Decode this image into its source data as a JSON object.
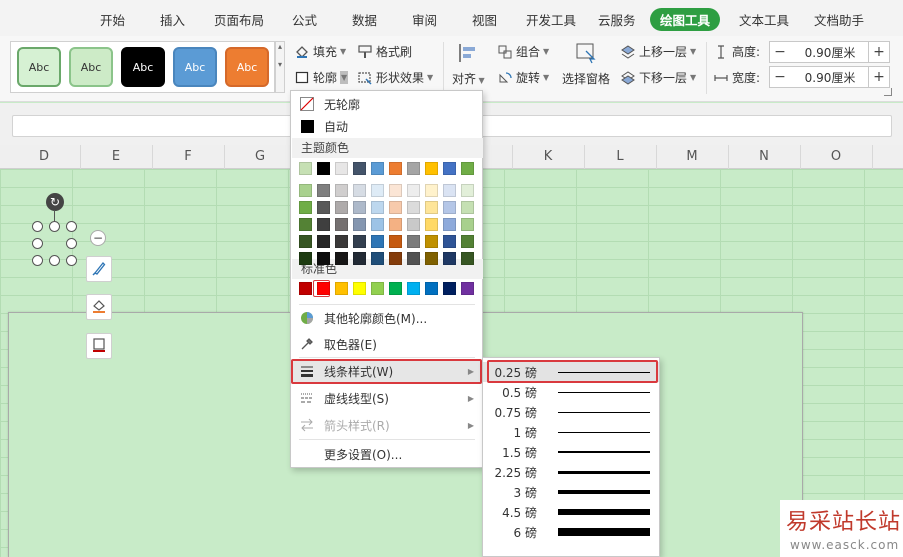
{
  "menu_tabs": [
    "开始",
    "插入",
    "页面布局",
    "公式",
    "数据",
    "审阅",
    "视图",
    "开发工具",
    "云服务",
    "绘图工具",
    "文本工具",
    "文档助手"
  ],
  "style_gallery": [
    {
      "label": "Abc",
      "bg": "#d6f1d3",
      "border": "#6aa86a",
      "color": "#333333"
    },
    {
      "label": "Abc",
      "bg": "#cdebc7",
      "border": "#8bc48a",
      "color": "#333333"
    },
    {
      "label": "Abc",
      "bg": "#000000",
      "border": "#000000",
      "color": "#ffffff"
    },
    {
      "label": "Abc",
      "bg": "#5b9bd5",
      "border": "#4a86bd",
      "color": "#ffffff"
    },
    {
      "label": "Abc",
      "bg": "#ed7d31",
      "border": "#d5692a",
      "color": "#ffffff"
    }
  ],
  "ribbon": {
    "fill": "填充",
    "format_painter": "格式刷",
    "outline": "轮廓",
    "shape_effects": "形状效果",
    "align": "对齐",
    "group": "组合",
    "rotate": "旋转",
    "selection_pane": "选择窗格",
    "bring_forward": "上移一层",
    "send_backward": "下移一层",
    "height_label": "高度:",
    "height_value": "0.90厘米",
    "width_label": "宽度:",
    "width_value": "0.90厘米",
    "minus": "−",
    "plus": "+"
  },
  "columns": [
    "D",
    "E",
    "F",
    "G",
    "H",
    "I",
    "J",
    "K",
    "L",
    "M",
    "N",
    "O"
  ],
  "dropdown": {
    "no_outline": "无轮廓",
    "auto": "自动",
    "theme_colors_title": "主题颜色",
    "theme_top_row": [
      "#c6e0b4",
      "#000000",
      "#e7e6e6",
      "#44546a",
      "#5b9bd5",
      "#ed7d31",
      "#a5a5a5",
      "#ffc000",
      "#4472c4",
      "#70ad47"
    ],
    "theme_shades": [
      [
        "#a9d18e",
        "#7f7f7f",
        "#d0cece",
        "#d6dce4",
        "#deebf6",
        "#fbe5d5",
        "#ededed",
        "#fff2cc",
        "#dae3f3",
        "#e2efd9"
      ],
      [
        "#70ad47",
        "#595959",
        "#aeaaaa",
        "#adb9ca",
        "#bdd7ee",
        "#f7caac",
        "#dbdbdb",
        "#fee599",
        "#b4c6e7",
        "#c5e0b3"
      ],
      [
        "#548235",
        "#3f3f3f",
        "#757070",
        "#8496b0",
        "#9dc3e6",
        "#f4b183",
        "#c9c9c9",
        "#ffd966",
        "#8eaadb",
        "#a8d08d"
      ],
      [
        "#375623",
        "#262626",
        "#3a3838",
        "#333f4f",
        "#2e75b5",
        "#c55a11",
        "#7b7b7b",
        "#bf9000",
        "#2f5496",
        "#538135"
      ],
      [
        "#1e3c12",
        "#0d0d0d",
        "#171616",
        "#222a35",
        "#1f4e79",
        "#843c0b",
        "#525252",
        "#7f6000",
        "#1f3864",
        "#375623"
      ]
    ],
    "standard_colors_title": "标准色",
    "standard_colors": [
      "#c00000",
      "#ff0000",
      "#ffc000",
      "#ffff00",
      "#92d050",
      "#00b050",
      "#00b0f0",
      "#0070c0",
      "#002060",
      "#7030a0"
    ],
    "more_colors": "其他轮廓颜色(M)...",
    "eyedropper": "取色器(E)",
    "line_style": "线条样式(W)",
    "dash_type": "虚线线型(S)",
    "arrow_style": "箭头样式(R)",
    "more_settings": "更多设置(O)..."
  },
  "line_weights": [
    "0.25 磅",
    "0.5 磅",
    "0.75 磅",
    "1 磅",
    "1.5 磅",
    "2.25 磅",
    "3 磅",
    "4.5 磅",
    "6 磅"
  ],
  "line_weight_values": [
    0.25,
    0.5,
    0.75,
    1,
    1.5,
    2.25,
    3,
    4.5,
    6
  ],
  "watermark": {
    "title": "易采站长站",
    "url": "www.easck.com"
  }
}
